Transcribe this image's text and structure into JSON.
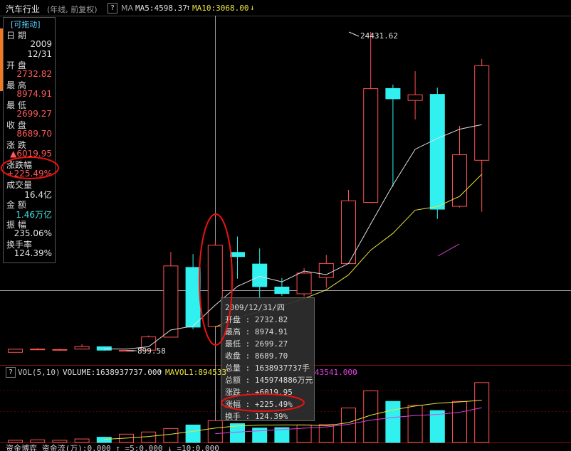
{
  "header": {
    "title": "汽车行业",
    "period": "(年线, 前复权)",
    "help": "?",
    "ma_label": "MA",
    "ma5": "MA5:4598.37",
    "ma10": "MA10:3068.00",
    "up_arrow": "↑",
    "down_arrow": "↓"
  },
  "side_panel": {
    "drag_label": "[可拖动]",
    "date_label": "日  期",
    "year": "2009",
    "date": "12/31",
    "open_label": "开  盘",
    "open": "2732.82",
    "high_label": "最  高",
    "high": "8974.91",
    "low_label": "最  低",
    "low": "2699.27",
    "close_label": "收  盘",
    "close": "8689.70",
    "change_label": "涨  跌",
    "change": "▲6019.95",
    "pct_label": "涨跌幅",
    "pct": "+225.49%",
    "volume_label": "成交量",
    "volume": "16.4亿",
    "amount_label": "金  额",
    "amount": "1.46万亿",
    "amplitude_label": "振  幅",
    "amplitude": "235.06%",
    "turnover_label": "换手率",
    "turnover": "124.39%"
  },
  "annotations": {
    "max_price": "24431.62",
    "min_price": "899.58"
  },
  "tooltip": {
    "date": "2009/12/31/四",
    "open": "开盘 : 2732.82",
    "high": "最高 : 8974.91",
    "low": "最低 : 2699.27",
    "close": "收盘 : 8689.70",
    "volume": "总量 : 1638937737手",
    "amount": "总额 : 145974886万元",
    "change": "涨跌 : +6019.95",
    "pct": "涨幅 : +225.49%",
    "turnover": "换手 : 124.39%"
  },
  "volume_bar": {
    "help": "?",
    "label": "VOL(5,10)",
    "volume": "VOLUME:1638937737.000",
    "mavol1": "MAVOL1:894533",
    "mavol2_tail": "43541.000",
    "up_arrow": "↑",
    "down_arrow": "↓"
  },
  "bottom_bar": {
    "text": "资金博弈  资金流(万):0.000  ↑ =5:0.000  ↓ =10:0.000"
  },
  "colors": {
    "up": "#ff5050",
    "down": "#30f0f0",
    "ma5": "#e0e0e0",
    "ma10": "#e8e040",
    "mavol2": "#e040e0"
  },
  "chart_data": {
    "type": "candlestick",
    "price_candles": [
      {
        "o": 780,
        "h": 1010,
        "l": 780,
        "c": 1010
      },
      {
        "o": 1020,
        "h": 1090,
        "l": 980,
        "c": 1020
      },
      {
        "o": 985,
        "h": 1050,
        "l": 960,
        "c": 985
      },
      {
        "o": 1020,
        "h": 1380,
        "l": 1000,
        "c": 1210
      },
      {
        "o": 1190,
        "h": 1200,
        "l": 900,
        "c": 940
      },
      {
        "o": 900,
        "h": 960,
        "l": 880,
        "c": 920
      },
      {
        "o": 940,
        "h": 2020,
        "l": 900,
        "c": 1920
      },
      {
        "o": 1900,
        "h": 8200,
        "l": 1900,
        "c": 7160
      },
      {
        "o": 7050,
        "h": 8030,
        "l": 2480,
        "c": 2640
      },
      {
        "o": 2700,
        "h": 8970,
        "l": 2700,
        "c": 8690
      },
      {
        "o": 8160,
        "h": 9330,
        "l": 6220,
        "c": 7850
      },
      {
        "o": 7300,
        "h": 8450,
        "l": 4720,
        "c": 5630
      },
      {
        "o": 5600,
        "h": 6260,
        "l": 4950,
        "c": 5120
      },
      {
        "o": 5100,
        "h": 7000,
        "l": 4900,
        "c": 6630
      },
      {
        "o": 6300,
        "h": 7980,
        "l": 5560,
        "c": 7340
      },
      {
        "o": 7330,
        "h": 12770,
        "l": 7330,
        "c": 11970
      },
      {
        "o": 11850,
        "h": 24430,
        "l": 11850,
        "c": 20250
      },
      {
        "o": 20260,
        "h": 20550,
        "l": 13000,
        "c": 19500
      },
      {
        "o": 19380,
        "h": 21540,
        "l": 17970,
        "c": 19800
      },
      {
        "o": 19830,
        "h": 20320,
        "l": 10630,
        "c": 11350
      },
      {
        "o": 11560,
        "h": 17500,
        "l": 11470,
        "c": 15370
      },
      {
        "o": 14960,
        "h": 22440,
        "l": 11160,
        "c": 21940
      }
    ],
    "volume_values": [
      0.5,
      0.6,
      0.5,
      0.8,
      1.2,
      1.9,
      2.4,
      3.2,
      4.0,
      5.0,
      4.3,
      3.3,
      3.4,
      4.0,
      4.1,
      7.9,
      11.8,
      9.4,
      8.5,
      7.3,
      9.4,
      13.7
    ]
  }
}
